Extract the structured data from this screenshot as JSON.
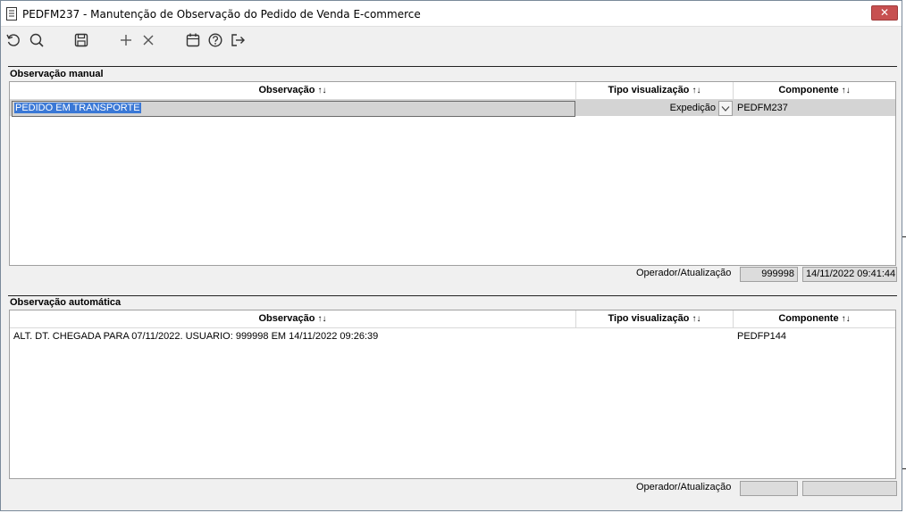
{
  "window": {
    "title": "PEDFM237 - Manutenção de Observação do Pedido de Venda E-commerce",
    "close_label": "✕"
  },
  "toolbar": {
    "buttons": [
      {
        "name": "refresh-icon"
      },
      {
        "name": "search-icon"
      },
      {
        "name": "save-icon"
      },
      {
        "name": "add-icon"
      },
      {
        "name": "delete-icon"
      },
      {
        "name": "calendar-icon"
      },
      {
        "name": "help-icon"
      },
      {
        "name": "exit-icon"
      }
    ]
  },
  "manual": {
    "section_title": "Observação manual",
    "columns": {
      "observacao": "Observação",
      "tipo": "Tipo visualização",
      "componente": "Componente",
      "sort_glyph": "↑↓"
    },
    "rows": [
      {
        "observacao": "PEDIDO EM TRANSPORTE",
        "tipo": "Expedição",
        "componente": "PEDFM237"
      }
    ],
    "footer": {
      "label": "Operador/Atualização",
      "operador": "999998",
      "atualizacao": "14/11/2022 09:41:44"
    }
  },
  "auto": {
    "section_title": "Observação automática",
    "columns": {
      "observacao": "Observação",
      "tipo": "Tipo visualização",
      "componente": "Componente",
      "sort_glyph": "↑↓"
    },
    "rows": [
      {
        "observacao": "ALT. DT. CHEGADA  PARA 07/11/2022. USUARIO: 999998 EM 14/11/2022 09:26:39",
        "tipo": "",
        "componente": "PEDFP144"
      }
    ],
    "footer": {
      "label": "Operador/Atualização",
      "operador": "",
      "atualizacao": ""
    }
  }
}
